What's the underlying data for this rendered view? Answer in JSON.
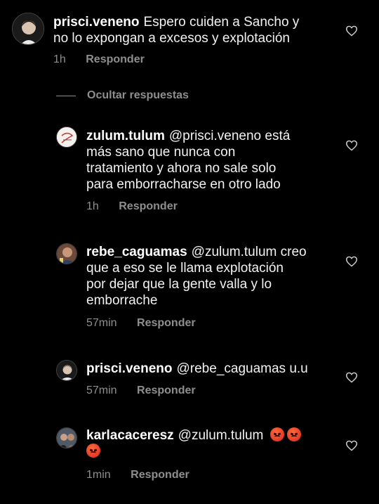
{
  "comments": [
    {
      "username": "prisci.veneno",
      "text_line1": "Espero cuiden a Sancho y",
      "text_line2": "no lo expongan a excesos y explotación",
      "time": "1h",
      "reply_label": "Responder"
    }
  ],
  "hide_replies_label": "Ocultar respuestas",
  "replies": [
    {
      "username": "zulum.tulum",
      "text_line1": "@prisci.veneno está",
      "text_line2": "más sano que nunca con",
      "text_line3": "tratamiento y ahora no sale solo",
      "text_line4": "para emborracharse en otro lado",
      "time": "1h",
      "reply_label": "Responder"
    },
    {
      "username": "rebe_caguamas",
      "text_line1": "@zulum.tulum creo",
      "text_line2": "que a eso se le llama explotación",
      "text_line3": "por dejar que la gente valla y lo",
      "text_line4": "emborrache",
      "time": "57min",
      "reply_label": "Responder"
    },
    {
      "username": "prisci.veneno",
      "text_line1": "@rebe_caguamas u.u",
      "time": "57min",
      "reply_label": "Responder"
    },
    {
      "username": "karlacaceresz",
      "text_line1": "@zulum.tulum",
      "time": "1min",
      "reply_label": "Responder",
      "emoji": "angry-face"
    }
  ],
  "icons": {
    "like": "heart-outline-icon"
  },
  "colors": {
    "background": "#000000",
    "text": "#f2f2f2",
    "muted": "#8e8e8e"
  }
}
